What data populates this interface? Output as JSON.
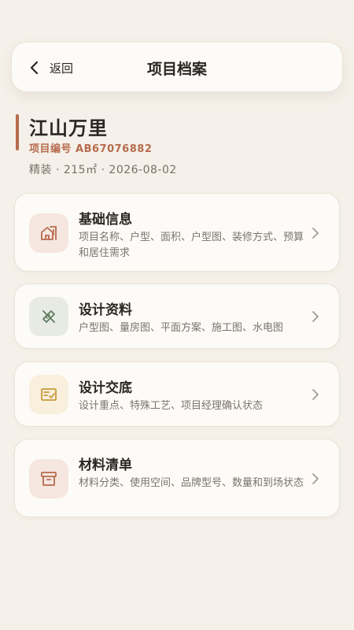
{
  "header": {
    "back_label": "返回",
    "title": "项目档案"
  },
  "project": {
    "name": "江山万里",
    "code": "项目编号 AB67076882",
    "meta": "精装 · 215㎡ · 2026-08-02"
  },
  "cards": [
    {
      "title": "基础信息",
      "desc": "项目名称、户型、面积、户型图、装修方式、预算和居住需求",
      "icon": "house-info-icon"
    },
    {
      "title": "设计资料",
      "desc": "户型图、量房图、平面方案、施工图、水电图",
      "icon": "ruler-pencil-icon"
    },
    {
      "title": "设计交底",
      "desc": "设计重点、特殊工艺、项目经理确认状态",
      "icon": "checklist-icon"
    },
    {
      "title": "材料清单",
      "desc": "材料分类、使用空间、品牌型号、数量和到场状态",
      "icon": "archive-box-icon"
    }
  ],
  "colors": {
    "background": "#f5f1ea",
    "accent": "#b76b4d",
    "card_bg": "#fdfbf7",
    "icon_bg_basic": "#f5e6df",
    "icon_bg_design": "#e7ebe3",
    "icon_bg_briefing": "#f8efdd",
    "icon_bg_materials": "#f5e6df"
  }
}
